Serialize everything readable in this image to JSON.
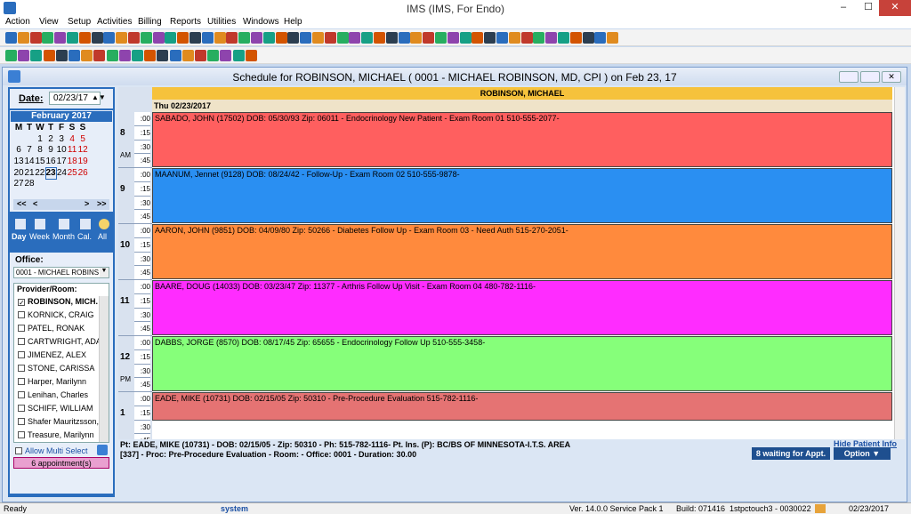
{
  "app": {
    "title": "IMS (IMS, For Endo)",
    "minimize": "–",
    "maximize": "☐",
    "close": "✕"
  },
  "menu": [
    "Action",
    "View",
    "Setup",
    "Activities",
    "Billing",
    "Reports",
    "Utilities",
    "Windows",
    "Help"
  ],
  "schedule_window": {
    "title": "Schedule for ROBINSON, MICHAEL ( 0001 - MICHAEL ROBINSON, MD, CPI )  on  Feb 23, 17"
  },
  "date_picker": {
    "label": "Date:",
    "value": "02/23/17"
  },
  "calendar": {
    "month": "February 2017",
    "weekdays": [
      "M",
      "T",
      "W",
      "T",
      "F",
      "S",
      "S"
    ],
    "weeks": [
      [
        "",
        "",
        "1",
        "2",
        "3",
        "4",
        "5"
      ],
      [
        "6",
        "7",
        "8",
        "9",
        "10",
        "11",
        "12"
      ],
      [
        "13",
        "14",
        "15",
        "16",
        "17",
        "18",
        "19"
      ],
      [
        "20",
        "21",
        "22",
        "23",
        "24",
        "25",
        "26"
      ],
      [
        "27",
        "28",
        "",
        "",
        "",
        "",
        ""
      ]
    ],
    "selected": "23",
    "prev_label": "<<",
    "prev1": "<",
    "next1": ">",
    "next_label": ">>"
  },
  "views": [
    "Day",
    "Week",
    "Month",
    "Cal.",
    "All"
  ],
  "office": {
    "label": "Office:",
    "value": "0001 - MICHAEL ROBINS"
  },
  "providers": {
    "label": "Provider/Room:",
    "items": [
      {
        "name": "ROBINSON, MICH.",
        "checked": true
      },
      {
        "name": "KORNICK, CRAIG",
        "checked": false
      },
      {
        "name": "PATEL, RONAK",
        "checked": false
      },
      {
        "name": "CARTWRIGHT, ADAM",
        "checked": false
      },
      {
        "name": "JIMENEZ, ALEX",
        "checked": false
      },
      {
        "name": "STONE, CARISSA",
        "checked": false
      },
      {
        "name": "Harper, Marilynn",
        "checked": false
      },
      {
        "name": "Lenihan, Charles",
        "checked": false
      },
      {
        "name": "SCHIFF, WILLIAM",
        "checked": false
      },
      {
        "name": "Shafer Mauritzsson, Ja",
        "checked": false
      },
      {
        "name": "Treasure, Marilynn",
        "checked": false
      }
    ]
  },
  "allow_multi_select": "Allow Multi Select",
  "appointments_count": "6 appointment(s)",
  "column_header": "ROBINSON, MICHAEL",
  "day_header": "Thu 02/23/2017",
  "hours": [
    {
      "h": "8",
      "ampm": "AM"
    },
    {
      "h": "9",
      "ampm": ""
    },
    {
      "h": "10",
      "ampm": ""
    },
    {
      "h": "11",
      "ampm": ""
    },
    {
      "h": "12",
      "ampm": "PM"
    },
    {
      "h": "1",
      "ampm": ""
    }
  ],
  "ticks": [
    ":00",
    ":15",
    ":30",
    ":45"
  ],
  "appointments": [
    {
      "text": "SABADO, JOHN  (17502)  DOB: 05/30/93  Zip: 06011 -  Endocrinology New Patient - Exam Room 01     510-555-2077-",
      "color": "#ff5f5f"
    },
    {
      "text": "MAANUM, Jennet  (9128)  DOB: 08/24/42 -  Follow-Up - Exam Room 02     510-555-9878-",
      "color": "#2a8ff2"
    },
    {
      "text": "AARON, JOHN  (9851)  DOB: 04/09/80  Zip: 50266 -  Diabetes Follow Up - Exam Room 03 - Need Auth     515-270-2051-",
      "color": "#ff8a3d"
    },
    {
      "text": "BAARE, DOUG  (14033)  DOB: 03/23/47  Zip: 11377 -  Arthris Follow Up Visit - Exam Room 04     480-782-1116-",
      "color": "#ff2cff"
    },
    {
      "text": "DABBS, JORGE  (8570)  DOB: 08/17/45  Zip: 65655 -  Endocrinology Follow Up     510-555-3458-",
      "color": "#86ff7a"
    },
    {
      "text": "EADE, MIKE  (10731)  DOB: 02/15/05  Zip: 50310 -  Pre-Procedure Evaluation     515-782-1116-",
      "color": "#e57373"
    }
  ],
  "info": {
    "line1": "Pt: EADE, MIKE  (10731) - DOB: 02/15/05 - Zip: 50310 - Ph: 515-782-1116- Pt. Ins. (P): BC/BS OF MINNESOTA-I.T.S. AREA",
    "line2": "[337]  - Proc: Pre-Procedure Evaluation - Room:   - Office: 0001  - Duration: 30.00",
    "hide": "Hide Patient Info",
    "waiting": "8 waiting for Appt.",
    "option": "Option"
  },
  "status": {
    "ready": "Ready",
    "user": "system",
    "version": "Ver. 14.0.0 Service Pack 1",
    "build": "Build: 071416",
    "station": "1stpctouch3 - 0030022",
    "date": "02/23/2017"
  }
}
